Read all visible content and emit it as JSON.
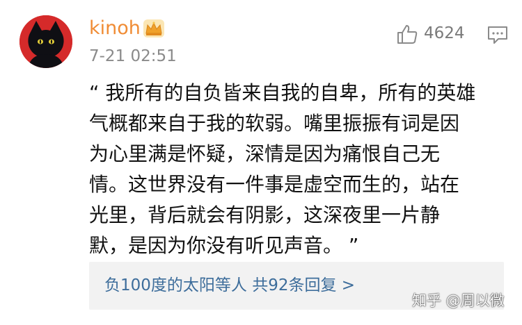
{
  "comment": {
    "username": "kinoh",
    "timestamp": "7-21 02:51",
    "like_count": "4624",
    "text_lines": [
      "“ 我所有的自负皆来自我的自卑，所有的英雄",
      "气概都来自于我的软弱。嘴里振振有词是因",
      "为心里满是怀疑，深情是因为痛恨自己无",
      "情。这世界没有一件事是虚空而生的，站在",
      "光里，背后就会有阴影，这深夜里一片静",
      "默，是因为你没有听见声音。 ”"
    ],
    "reply_summary": "负100度的太阳等人  共92条回复 >"
  },
  "watermark": "知乎 @周以微",
  "icons": {
    "avatar": "black-cat-avatar",
    "badge": "crown-icon",
    "like": "thumbs-up-icon",
    "reply": "comment-icon"
  },
  "colors": {
    "username": "#f08c35",
    "timestamp": "#8a8a8a",
    "reply_link": "#3d6d9b",
    "reply_bg": "#f2f2f2",
    "avatar_bg": "#d52a2a"
  }
}
